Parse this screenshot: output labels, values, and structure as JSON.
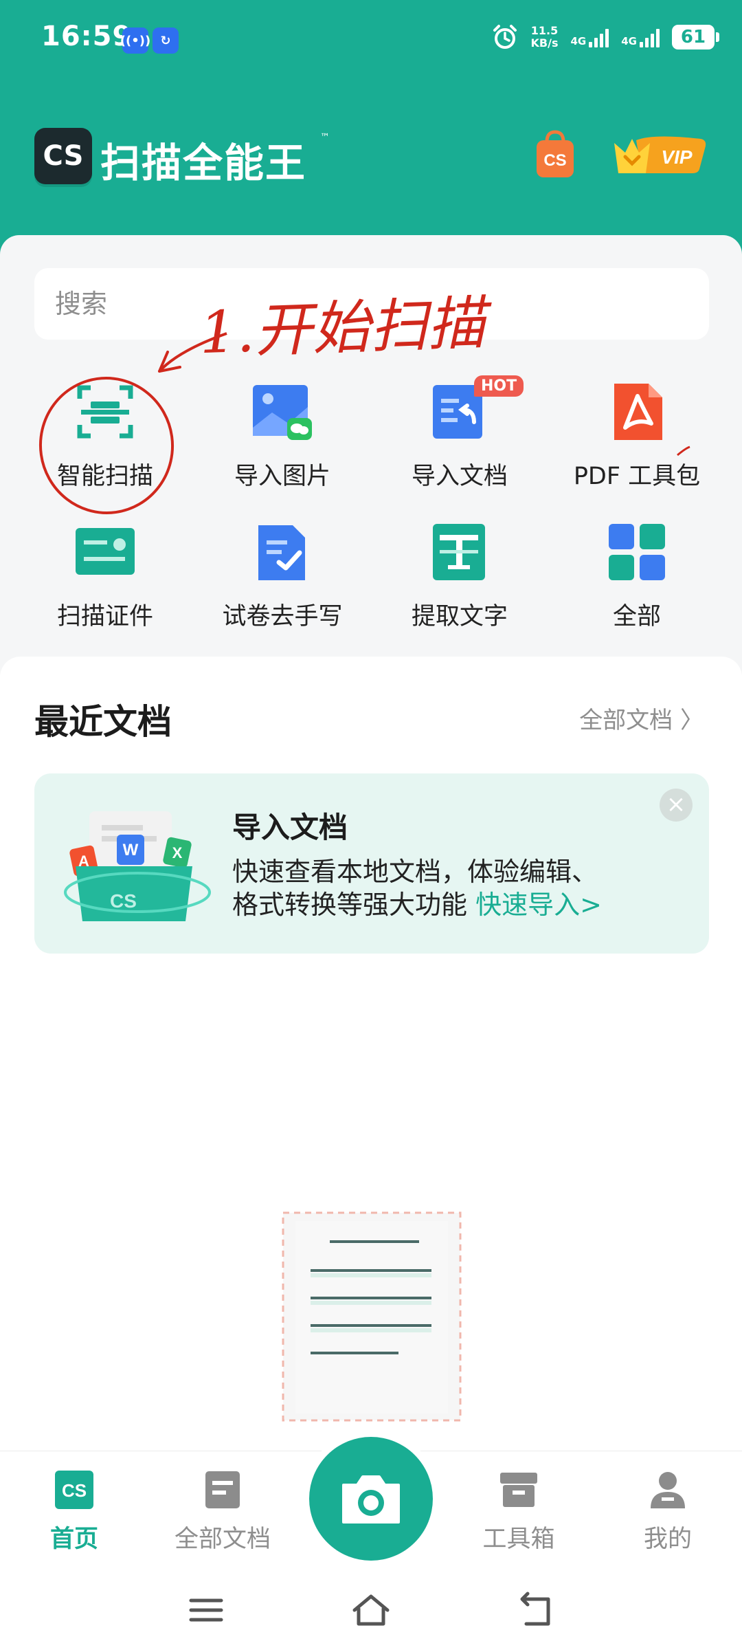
{
  "status_bar": {
    "time": "16:59",
    "net_speed_value": "11.5",
    "net_speed_unit": "KB/s",
    "sim1": "4G",
    "sim2": "4G",
    "battery": "61"
  },
  "header": {
    "logo_text": "CS",
    "app_name": "扫描全能王",
    "trademark": "™",
    "shop_badge": "CS",
    "vip_label": "VIP"
  },
  "search": {
    "placeholder": "搜索"
  },
  "annotation": {
    "handwritten": "1.开始扫描"
  },
  "tools": [
    {
      "label": "智能扫描",
      "icon": "smart-scan-icon"
    },
    {
      "label": "导入图片",
      "icon": "import-image-icon"
    },
    {
      "label": "导入文档",
      "icon": "import-doc-icon",
      "badge": "HOT"
    },
    {
      "label": "PDF 工具包",
      "icon": "pdf-toolkit-icon"
    },
    {
      "label": "扫描证件",
      "icon": "id-card-icon"
    },
    {
      "label": "试卷去手写",
      "icon": "exam-paper-icon"
    },
    {
      "label": "提取文字",
      "icon": "extract-text-icon"
    },
    {
      "label": "全部",
      "icon": "all-tools-icon"
    }
  ],
  "recent": {
    "title": "最近文档",
    "all_docs": "全部文档 〉"
  },
  "banner": {
    "title": "导入文档",
    "line1": "快速查看本地文档，体验编辑、",
    "line2": "格式转换等强大功能",
    "link": "快速导入>",
    "close": "×",
    "art_badges": [
      "A",
      "W",
      "X",
      "CS"
    ]
  },
  "bottom_nav": {
    "items": [
      {
        "label": "首页",
        "active": true
      },
      {
        "label": "全部文档",
        "active": false
      },
      {
        "label": "工具箱",
        "active": false
      },
      {
        "label": "我的",
        "active": false
      }
    ],
    "home_icon_text": "CS"
  },
  "colors": {
    "brand": "#19ad93",
    "accent_red": "#ee5a4f",
    "annotation_red": "#d0281c",
    "background": "#f5f6f7"
  }
}
